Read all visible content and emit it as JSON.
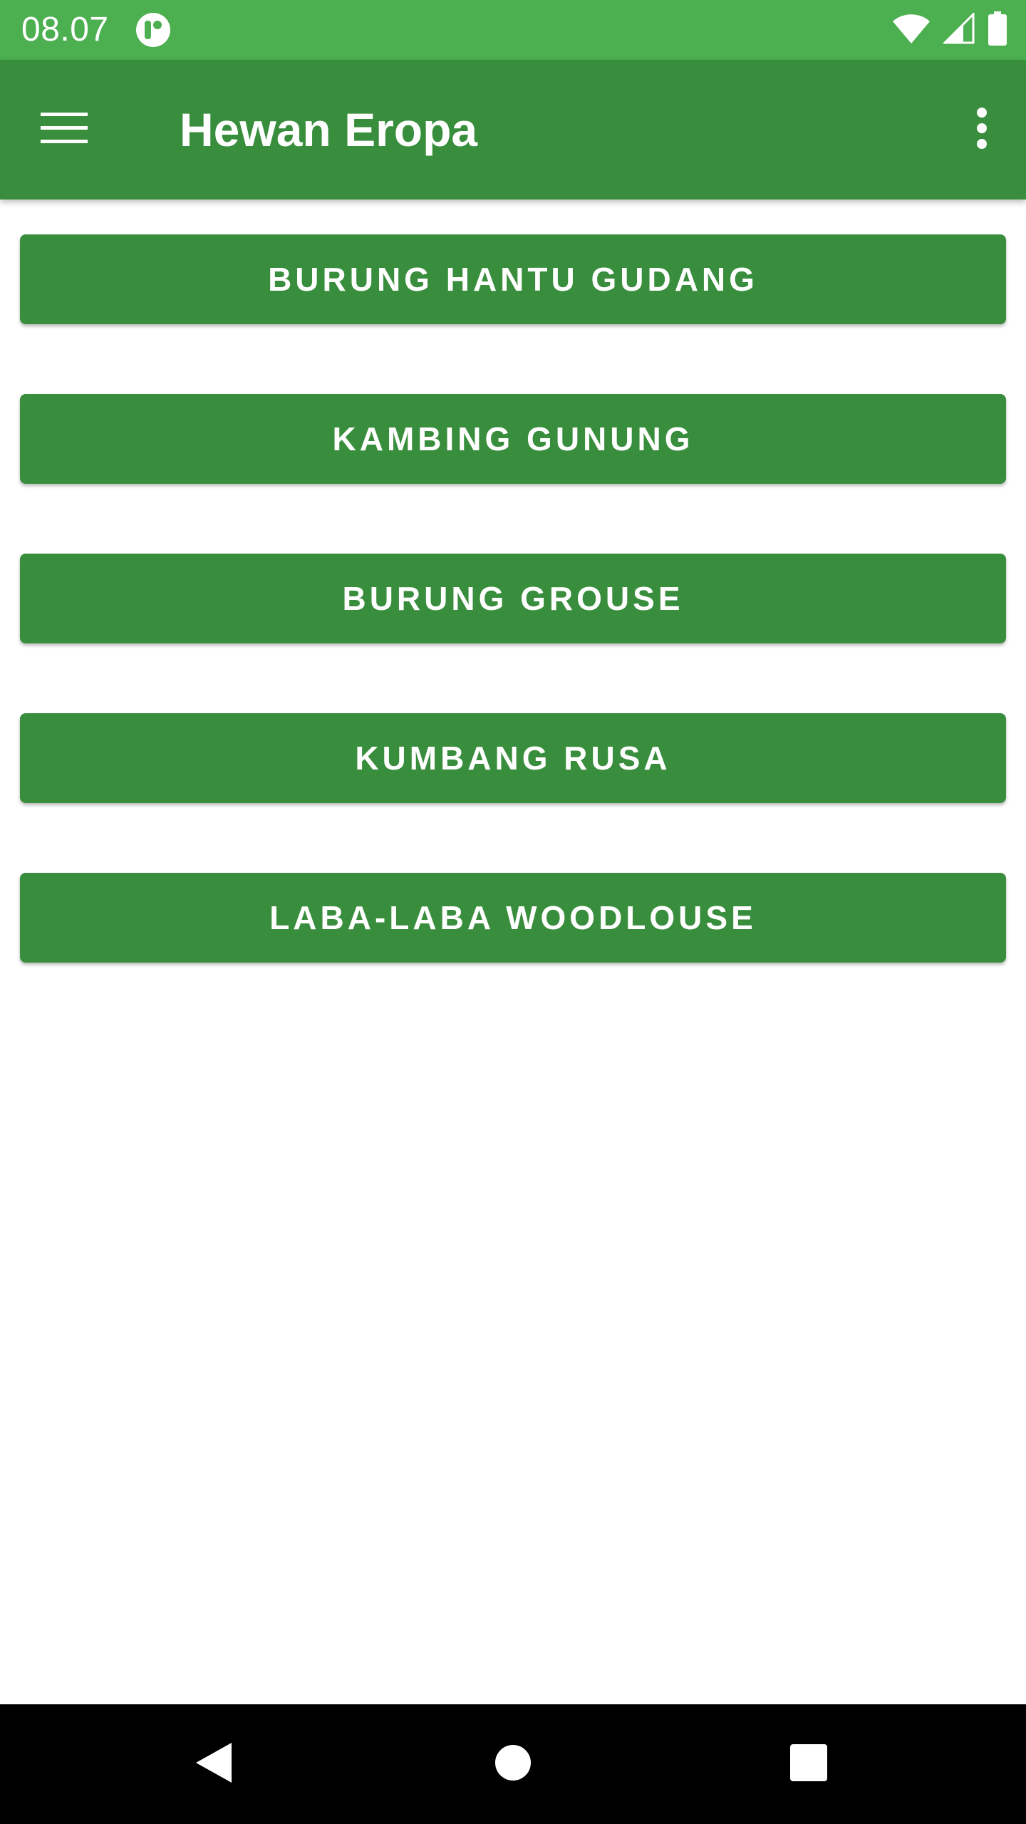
{
  "status_bar": {
    "time": "08.07",
    "app_icon": "notification-app-icon",
    "icons": [
      "wifi-icon",
      "cell-signal-icon",
      "battery-icon"
    ],
    "color": "#4caf50"
  },
  "app_bar": {
    "title": "Hewan Eropa",
    "menu_icon": "hamburger-menu-icon",
    "overflow_icon": "more-vert-icon",
    "color": "#388e3c"
  },
  "buttons": [
    {
      "label": "BURUNG HANTU GUDANG"
    },
    {
      "label": "KAMBING GUNUNG"
    },
    {
      "label": "BURUNG GROUSE"
    },
    {
      "label": "KUMBANG RUSA"
    },
    {
      "label": "LABA-LABA WOODLOUSE"
    }
  ],
  "button_color": "#388e3c",
  "nav_bar": {
    "icons": [
      "back-icon",
      "home-icon",
      "recents-icon"
    ]
  }
}
